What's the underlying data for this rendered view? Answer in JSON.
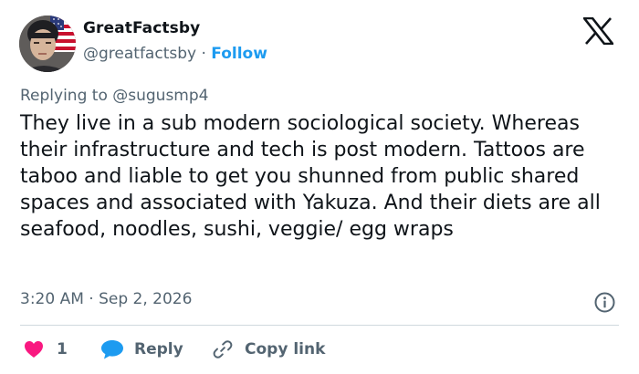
{
  "author": {
    "display_name": "GreatFactsby",
    "handle": "@greatfactsby",
    "separator": "·",
    "follow_label": "Follow"
  },
  "reply_context": {
    "prefix": "Replying to ",
    "mention": "@sugusmp4"
  },
  "tweet": {
    "text": "They live in a sub modern sociological society. Whereas their infrastructure and tech is post modern. Tattoos are taboo and liable to get you shunned from public shared spaces and associated with Yakuza. And their diets are all seafood, noodles, sushi, veggie/ egg wraps",
    "time": "3:20 AM",
    "separator": "·",
    "date": "Sep 2, 2026"
  },
  "actions": {
    "like_count": "1",
    "reply_label": "Reply",
    "copy_label": "Copy link"
  },
  "icons": {
    "logo": "x-logo-icon",
    "info": "info-icon",
    "like": "heart-icon",
    "reply": "speech-bubble-icon",
    "copy": "link-icon"
  },
  "colors": {
    "accent": "#1d9bf0",
    "like": "#f91880",
    "text": "#0f1419",
    "muted": "#536471",
    "divider": "#cfd9de"
  }
}
